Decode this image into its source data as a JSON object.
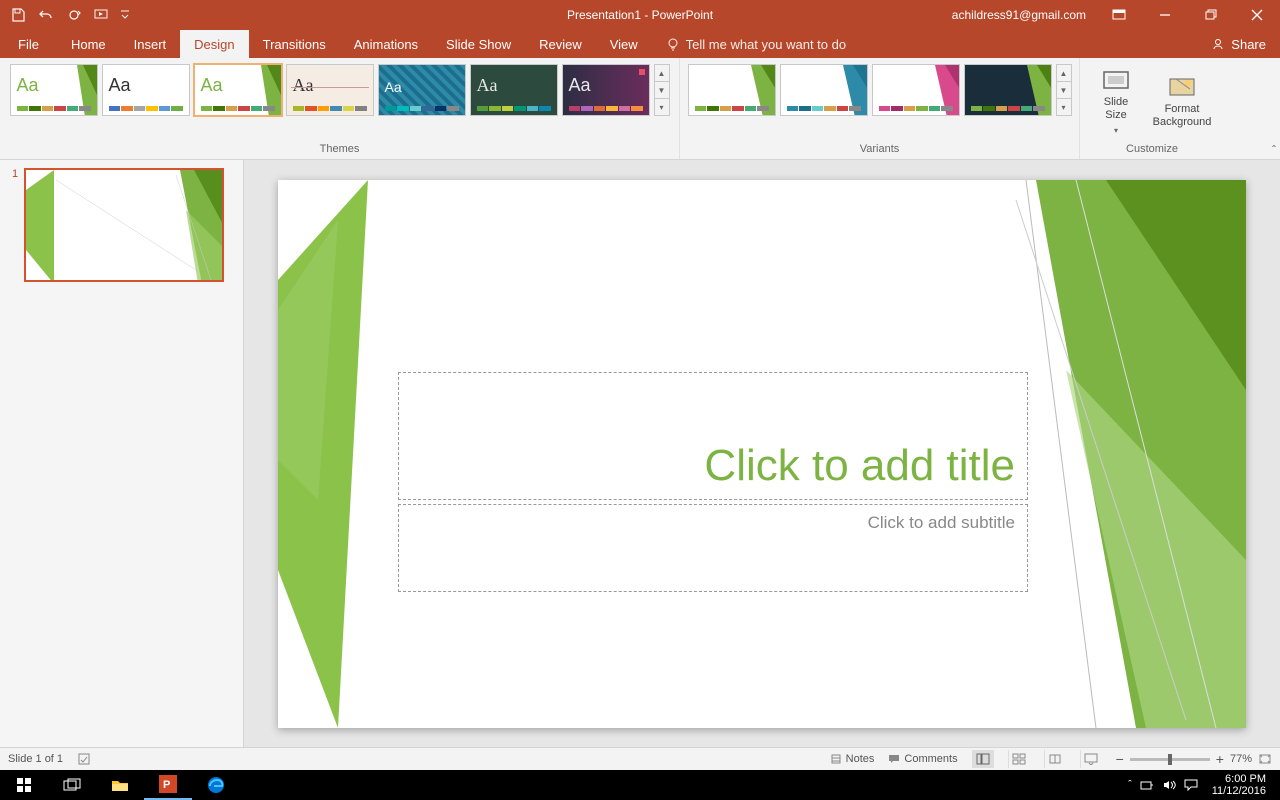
{
  "app": {
    "title": "Presentation1  -  PowerPoint",
    "account": "achildress91@gmail.com"
  },
  "tabs": {
    "file": "File",
    "home": "Home",
    "insert": "Insert",
    "design": "Design",
    "transitions": "Transitions",
    "animations": "Animations",
    "slideshow": "Slide Show",
    "review": "Review",
    "view": "View",
    "tellme": "Tell me what you want to do",
    "share": "Share"
  },
  "ribbon": {
    "themes_label": "Themes",
    "variants_label": "Variants",
    "customize_label": "Customize",
    "slide_size": "Slide\nSize",
    "format_bg": "Format\nBackground",
    "theme_thumbs": [
      {
        "aa_color": "#7CB342",
        "accent": "green"
      },
      {
        "aa_color": "#333333",
        "accent": "multi"
      },
      {
        "aa_color": "#7CB342",
        "accent": "green"
      },
      {
        "aa_color": "#333333",
        "accent": "red"
      },
      {
        "aa_color": "#ffffff",
        "accent": "teal"
      },
      {
        "aa_color": "#e8e8e8",
        "accent": "dark"
      },
      {
        "aa_color": "#e8e8e8",
        "accent": "purple"
      }
    ]
  },
  "slide": {
    "number": "1",
    "title_placeholder": "Click to add title",
    "subtitle_placeholder": "Click to add subtitle"
  },
  "status": {
    "slide_count": "Slide 1 of 1",
    "notes": "Notes",
    "comments": "Comments",
    "zoom": "77%"
  },
  "taskbar": {
    "time": "6:00 PM",
    "date": "11/12/2016"
  }
}
